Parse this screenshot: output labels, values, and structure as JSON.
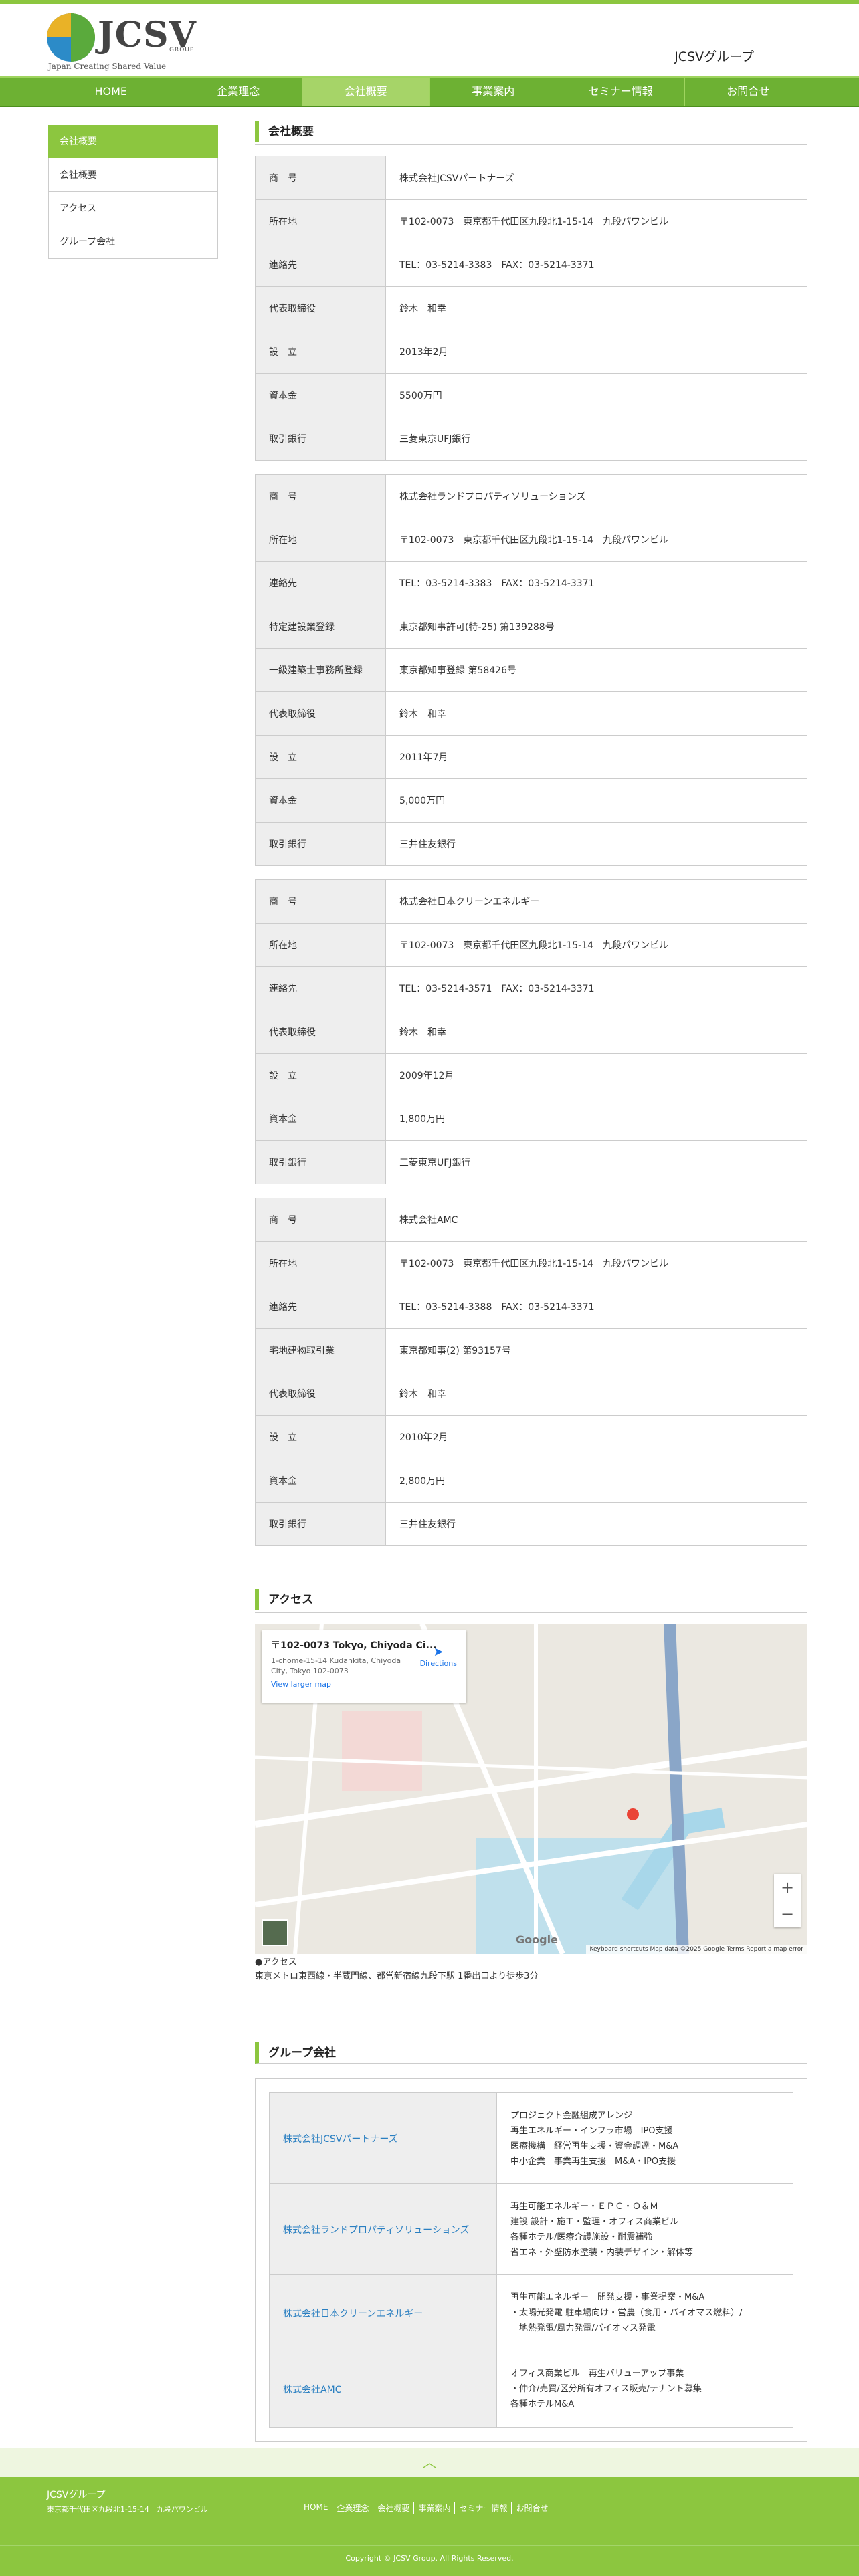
{
  "header": {
    "logo_text": "JCSV",
    "logo_group": "GROUP",
    "logo_tagline": "Japan Creating Shared Value",
    "site_title": "JCSVグループ"
  },
  "nav": {
    "items": [
      {
        "label": "HOME"
      },
      {
        "label": "企業理念"
      },
      {
        "label": "会社概要"
      },
      {
        "label": "事業案内"
      },
      {
        "label": "セミナー情報"
      },
      {
        "label": "お問合せ"
      }
    ],
    "active": "会社概要"
  },
  "sidebar": {
    "items": [
      {
        "label": "会社概要"
      },
      {
        "label": "会社概要"
      },
      {
        "label": "アクセス"
      },
      {
        "label": "グループ会社"
      }
    ]
  },
  "company_section": {
    "title": "会社概要",
    "companies": [
      {
        "rows": [
          {
            "k": "商　号",
            "v": "株式会社JCSVパートナーズ"
          },
          {
            "k": "所在地",
            "v": "〒102-0073　東京都千代田区九段北1-15-14　九段パワンビル"
          },
          {
            "k": "連絡先",
            "v": "TEL：03-5214-3383　FAX：03-5214-3371"
          },
          {
            "k": "代表取締役",
            "v": "鈴木　和幸"
          },
          {
            "k": "設　立",
            "v": "2013年2月"
          },
          {
            "k": "資本金",
            "v": "5500万円"
          },
          {
            "k": "取引銀行",
            "v": "三菱東京UFJ銀行"
          }
        ]
      },
      {
        "rows": [
          {
            "k": "商　号",
            "v": "株式会社ランドプロパティソリューションズ"
          },
          {
            "k": "所在地",
            "v": "〒102-0073　東京都千代田区九段北1-15-14　九段パワンビル"
          },
          {
            "k": "連絡先",
            "v": "TEL：03-5214-3383　FAX：03-5214-3371"
          },
          {
            "k": "特定建設業登録",
            "v": "東京都知事許可(特-25) 第139288号"
          },
          {
            "k": "一級建築士事務所登録",
            "v": "東京都知事登録 第58426号"
          },
          {
            "k": "代表取締役",
            "v": "鈴木　和幸"
          },
          {
            "k": "設　立",
            "v": "2011年7月"
          },
          {
            "k": "資本金",
            "v": "5,000万円"
          },
          {
            "k": "取引銀行",
            "v": "三井住友銀行"
          }
        ]
      },
      {
        "rows": [
          {
            "k": "商　号",
            "v": "株式会社日本クリーンエネルギー"
          },
          {
            "k": "所在地",
            "v": "〒102-0073　東京都千代田区九段北1-15-14　九段パワンビル"
          },
          {
            "k": "連絡先",
            "v": "TEL：03-5214-3571　FAX：03-5214-3371"
          },
          {
            "k": "代表取締役",
            "v": "鈴木　和幸"
          },
          {
            "k": "設　立",
            "v": "2009年12月"
          },
          {
            "k": "資本金",
            "v": "1,800万円"
          },
          {
            "k": "取引銀行",
            "v": "三菱東京UFJ銀行"
          }
        ]
      },
      {
        "rows": [
          {
            "k": "商　号",
            "v": "株式会社AMC"
          },
          {
            "k": "所在地",
            "v": "〒102-0073　東京都千代田区九段北1-15-14　九段パワンビル"
          },
          {
            "k": "連絡先",
            "v": "TEL：03-5214-3388　FAX：03-5214-3371"
          },
          {
            "k": "宅地建物取引業",
            "v": "東京都知事(2) 第93157号"
          },
          {
            "k": "代表取締役",
            "v": "鈴木　和幸"
          },
          {
            "k": "設　立",
            "v": "2010年2月"
          },
          {
            "k": "資本金",
            "v": "2,800万円"
          },
          {
            "k": "取引銀行",
            "v": "三井住友銀行"
          }
        ]
      }
    ]
  },
  "access": {
    "title": "アクセス",
    "map_card_title": "〒102-0073 Tokyo, Chiyoda Ci...",
    "map_card_address": "1-chōme-15-14 Kudankita, Chiyoda City, Tokyo 102-0073",
    "map_card_link": "View larger map",
    "map_card_directions": "Directions",
    "map_footer": "Keyboard shortcuts   Map data ©2025 Google   Terms   Report a map error",
    "map_google": "Google",
    "zoom_in": "+",
    "zoom_out": "−",
    "line1": "●アクセス",
    "line2": "東京メトロ東西線・半蔵門線、都営新宿線九段下駅 1番出口より徒歩3分"
  },
  "group": {
    "title": "グループ会社",
    "rows": [
      {
        "name": "株式会社JCSVパートナーズ",
        "desc": [
          "プロジェクト金融組成アレンジ",
          "再生エネルギー・インフラ市場　IPO支援",
          "医療機構　経営再生支援・資金調達・M&A",
          "中小企業　事業再生支援　M&A・IPO支援"
        ]
      },
      {
        "name": "株式会社ランドプロパティソリューションズ",
        "desc": [
          "再生可能エネルギー・ＥＰＣ・Ｏ＆Ｍ",
          "建設 設計・施工・監理・オフィス商業ビル",
          "各種ホテル/医療介護施設・耐震補強",
          "省エネ・外壁防水塗装・内装デザイン・解体等"
        ]
      },
      {
        "name": "株式会社日本クリーンエネルギー",
        "desc": [
          "再生可能エネルギー　開発支援・事業提案・M&A",
          "・太陽光発電 駐車場向け・営農（食用・バイオマス燃料）/",
          "　地熱発電/風力発電/バイオマス発電"
        ]
      },
      {
        "name": "株式会社AMC",
        "desc": [
          "オフィス商業ビル　再生バリューアップ事業",
          "・仲介/売買/区分所有オフィス販売/テナント募集",
          "各種ホテルM&A"
        ]
      }
    ]
  },
  "footer": {
    "to_top": "︿",
    "name": "JCSVグループ",
    "address": "東京都千代田区九段北1-15-14　九段パワンビル",
    "links": [
      "HOME",
      "企業理念",
      "会社概要",
      "事業案内",
      "セミナー情報",
      "お問合せ"
    ],
    "copyright": "Copyright © JCSV Group. All Rights Reserved."
  },
  "colors": {
    "accent": "#8cc63f",
    "nav": "#6db133",
    "link": "#2a7fc1"
  }
}
